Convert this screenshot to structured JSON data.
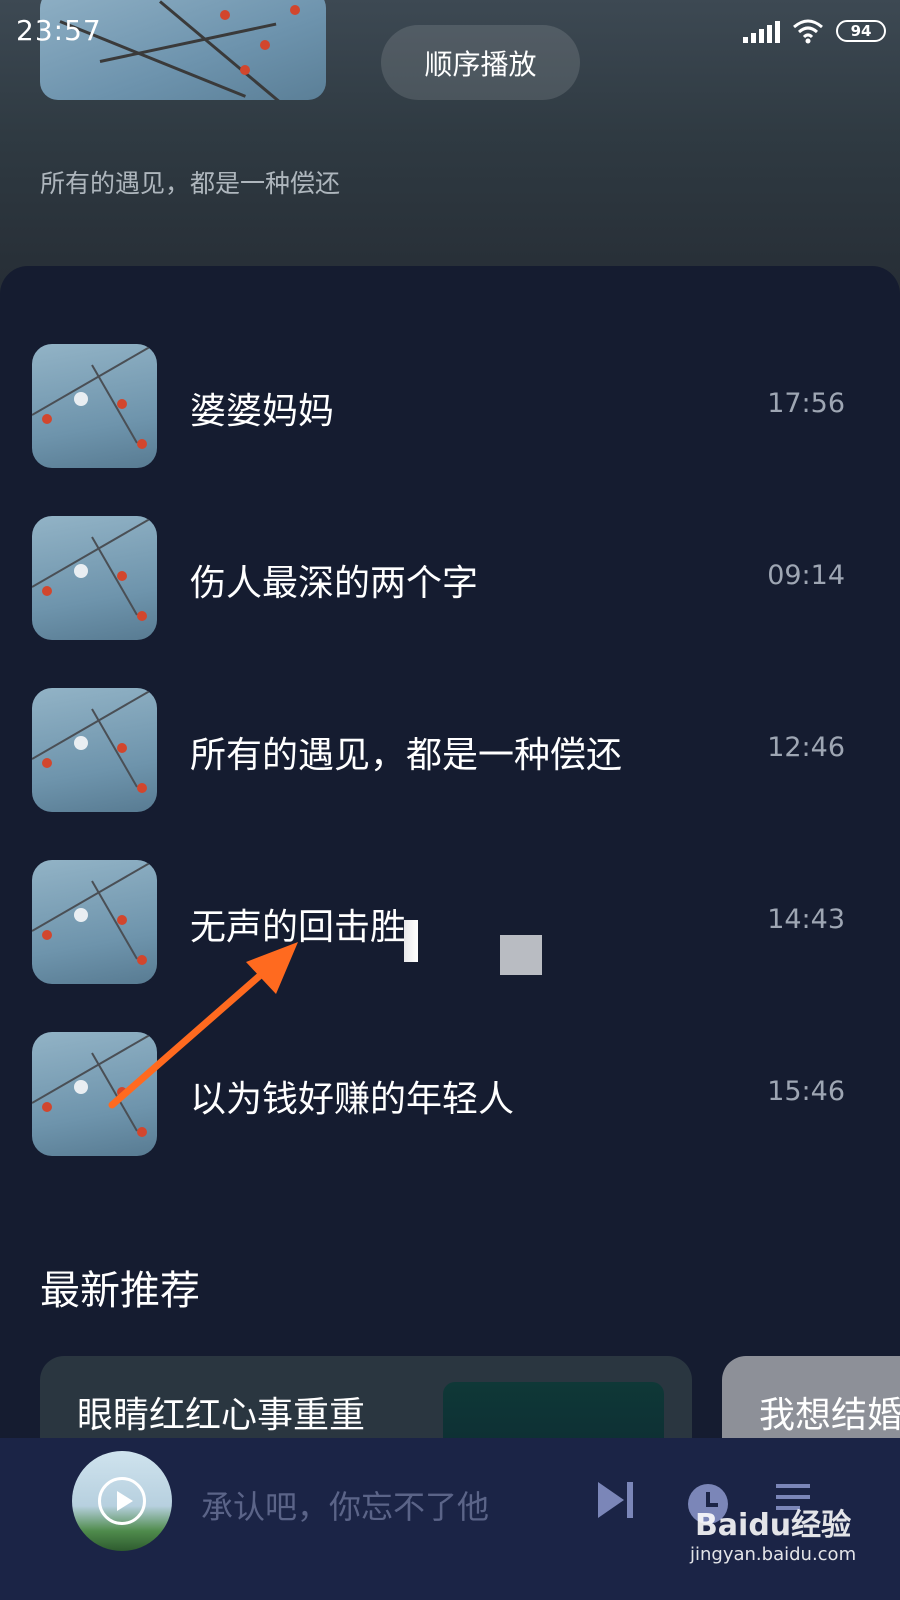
{
  "status_bar": {
    "time": "23:57",
    "battery": "94"
  },
  "header": {
    "play_mode_label": "顺序播放",
    "subtitle": "所有的遇见，都是一种偿还"
  },
  "tracks": [
    {
      "title": "婆婆妈妈",
      "duration": "17:56"
    },
    {
      "title": "伤人最深的两个字",
      "duration": "09:14"
    },
    {
      "title": "所有的遇见，都是一种偿还",
      "duration": "12:46"
    },
    {
      "title": "无声的回击胜",
      "duration": "14:43"
    },
    {
      "title": "以为钱好赚的年轻人",
      "duration": "15:46"
    }
  ],
  "recommend": {
    "section_title": "最新推荐",
    "cards": [
      {
        "title": "眼睛红红心事重重"
      },
      {
        "title": "我想结婚"
      }
    ]
  },
  "player": {
    "now_playing": "承认吧，你忘不了他"
  },
  "watermark": {
    "logo": "Baidu经验",
    "url": "jingyan.baidu.com"
  },
  "colors": {
    "background": "#151c30",
    "player_bar": "#1b2446",
    "annotation_arrow": "#ff6a1f"
  },
  "icons": [
    "signal-icon",
    "wifi-icon",
    "battery-icon",
    "play-icon",
    "next-track-icon",
    "timer-icon",
    "playlist-icon"
  ]
}
